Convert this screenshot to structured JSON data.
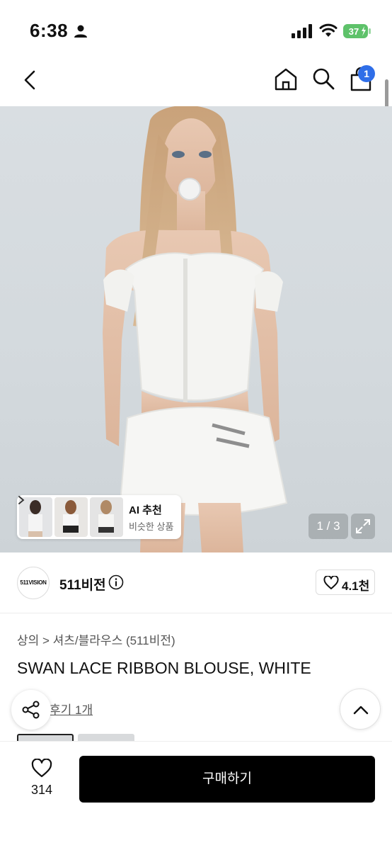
{
  "status_bar": {
    "time": "6:38",
    "battery": "37"
  },
  "nav": {
    "cart_badge": "1"
  },
  "hero": {
    "ai_card": {
      "title": "AI 추천",
      "subtitle": "비슷한 상품"
    },
    "page_indicator": "1 / 3"
  },
  "brand": {
    "logo_text": "511VISION",
    "name": "511비전",
    "like_count": "4.1천"
  },
  "product": {
    "breadcrumb": "상의 > 셔츠/블라우스 (511비전)",
    "title": "SWAN LACE RIBBON BLOUSE, WHITE",
    "review_link": "후기 1개"
  },
  "bottom_bar": {
    "wish_count": "314",
    "buy_label": "구매하기"
  },
  "colors": {
    "badge": "#2f6ee8",
    "buy_button": "#000000",
    "hero_bg": "#d5dbdf"
  },
  "icons": [
    "person-icon",
    "signal-icon",
    "wifi-icon",
    "battery-icon",
    "back-arrow-icon",
    "home-icon",
    "search-icon",
    "shopping-bag-icon",
    "chevron-right-icon",
    "expand-icon",
    "info-icon",
    "heart-icon",
    "share-icon",
    "chevron-up-icon"
  ]
}
